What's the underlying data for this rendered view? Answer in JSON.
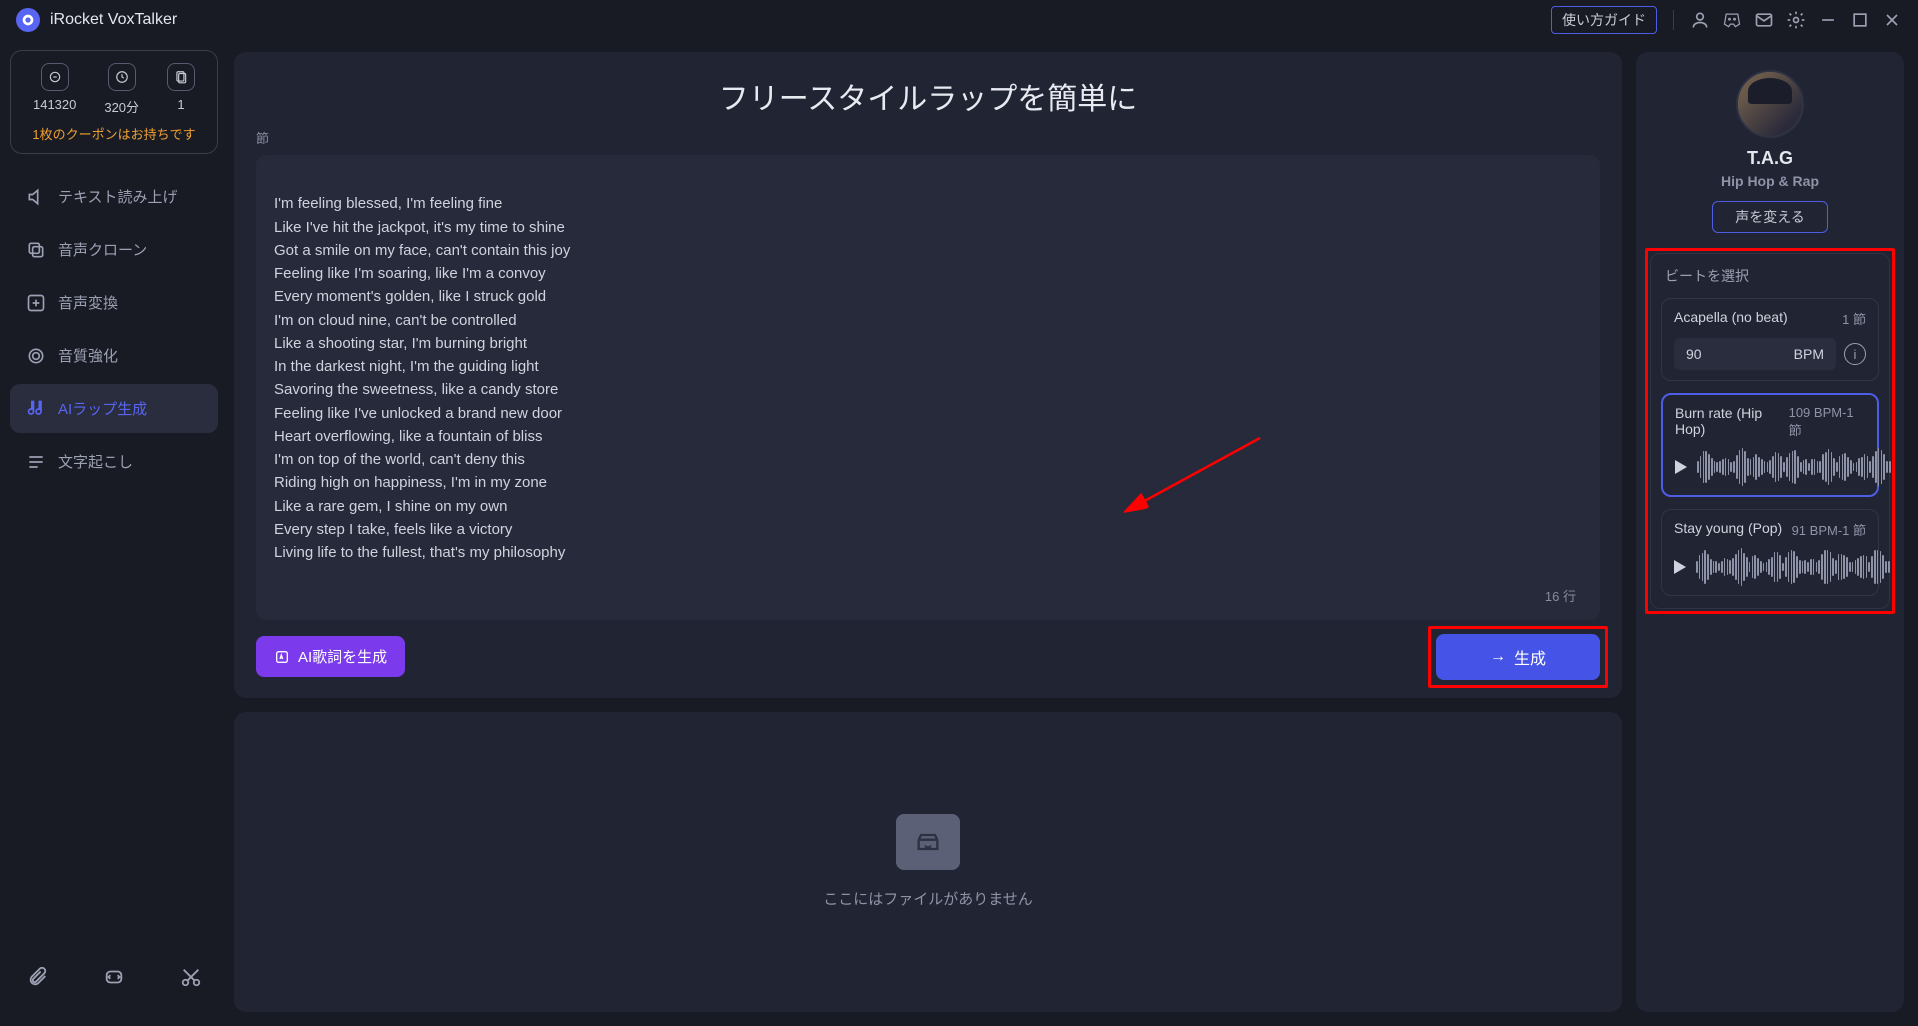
{
  "app": {
    "title": "iRocket VoxTalker"
  },
  "titlebar": {
    "guide": "使い方ガイド"
  },
  "stats": {
    "credits": "141320",
    "minutes": "320分",
    "sheets": "1",
    "coupon": "1枚のクーポンはお持ちです"
  },
  "nav": {
    "items": [
      {
        "icon": "speak",
        "label": "テキスト読み上げ"
      },
      {
        "icon": "clone",
        "label": "音声クローン"
      },
      {
        "icon": "convert",
        "label": "音声変換"
      },
      {
        "icon": "enhance",
        "label": "音質強化"
      },
      {
        "icon": "rap",
        "label": "AIラップ生成"
      },
      {
        "icon": "transcribe",
        "label": "文字起こし"
      }
    ]
  },
  "editor": {
    "title": "フリースタイルラップを簡単に",
    "section_label": "節",
    "lyrics": "I'm feeling blessed, I'm feeling fine\nLike I've hit the jackpot, it's my time to shine\nGot a smile on my face, can't contain this joy\nFeeling like I'm soaring, like I'm a convoy\nEvery moment's golden, like I struck gold\nI'm on cloud nine, can't be controlled\nLike a shooting star, I'm burning bright\nIn the darkest night, I'm the guiding light\nSavoring the sweetness, like a candy store\nFeeling like I've unlocked a brand new door\nHeart overflowing, like a fountain of bliss\nI'm on top of the world, can't deny this\nRiding high on happiness, I'm in my zone\nLike a rare gem, I shine on my own\nEvery step I take, feels like a victory\nLiving life to the fullest, that's my philosophy",
    "linecount": "16 行",
    "ai_lyrics_btn": "AI歌詞を生成",
    "generate_btn": "生成"
  },
  "empty": {
    "message": "ここにはファイルがありません"
  },
  "artist": {
    "name": "T.A.G",
    "genre": "Hip Hop & Rap",
    "change_btn": "声を変える"
  },
  "beats": {
    "section_title": "ビートを選択",
    "cards": [
      {
        "name": "Acapella (no beat)",
        "meta": "1 節",
        "bpm_value": "90",
        "bpm_label": "BPM"
      },
      {
        "name": "Burn rate (Hip Hop)",
        "meta": "109 BPM-1 節"
      },
      {
        "name": "Stay young (Pop)",
        "meta": "91 BPM-1 節"
      }
    ]
  }
}
